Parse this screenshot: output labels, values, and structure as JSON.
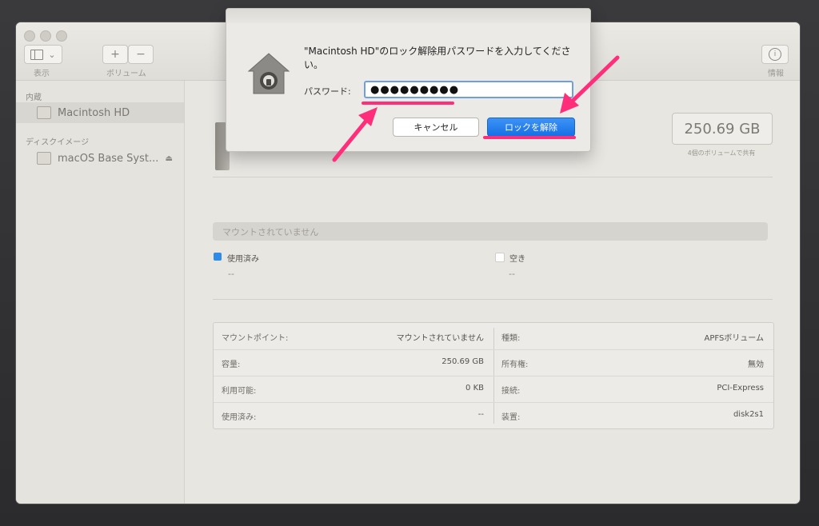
{
  "toolbar": {
    "view_label": "表示",
    "volume_label": "ボリューム",
    "info_label": "情報",
    "plus": "+",
    "minus": "−",
    "info_glyph": "i",
    "view_chevron": "⌄"
  },
  "sidebar": {
    "section_internal": "内蔵",
    "section_images": "ディスクイメージ",
    "items": [
      {
        "label": "Macintosh HD"
      },
      {
        "label": "macOS Base Syst..."
      }
    ],
    "eject_glyph": "⏏"
  },
  "volume": {
    "capacity": "250.69 GB",
    "capacity_sub": "4個のボリュームで共有",
    "mount_status": "マウントされていません"
  },
  "legend": {
    "used_label": "使用済み",
    "used_value": "--",
    "free_label": "空き",
    "free_value": "--",
    "used_color": "#2f8be6",
    "free_color": "#ffffff"
  },
  "info": {
    "left": [
      {
        "key": "マウントポイント:",
        "value": "マウントされていません"
      },
      {
        "key": "容量:",
        "value": "250.69 GB"
      },
      {
        "key": "利用可能:",
        "value": "0 KB"
      },
      {
        "key": "使用済み:",
        "value": "--"
      }
    ],
    "right": [
      {
        "key": "種類:",
        "value": "APFSボリューム"
      },
      {
        "key": "所有権:",
        "value": "無効"
      },
      {
        "key": "接続:",
        "value": "PCI-Express"
      },
      {
        "key": "装置:",
        "value": "disk2s1"
      }
    ]
  },
  "dialog": {
    "message": "\"Macintosh HD\"のロック解除用パスワードを入力してください。",
    "password_label": "パスワード:",
    "password_value": "●●●●●●●●●",
    "cancel_label": "キャンセル",
    "unlock_label": "ロックを解除",
    "icon": "lock-icon"
  },
  "annotation": {
    "highlight_color": "#ff2e7a"
  }
}
